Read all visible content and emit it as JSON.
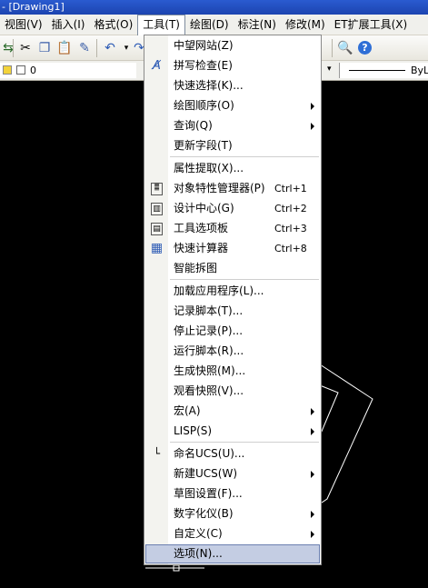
{
  "title_bar": {
    "text": "- [Drawing1]"
  },
  "menubar": [
    {
      "label": "视图(V)",
      "active": false
    },
    {
      "label": "插入(I)",
      "active": false
    },
    {
      "label": "格式(O)",
      "active": false
    },
    {
      "label": "工具(T)",
      "active": true
    },
    {
      "label": "绘图(D)",
      "active": false
    },
    {
      "label": "标注(N)",
      "active": false
    },
    {
      "label": "修改(M)",
      "active": false
    },
    {
      "label": "ET扩展工具(X)",
      "active": false
    }
  ],
  "layer_toolbar": {
    "current_layer": "0",
    "linetype_value": "ByL"
  },
  "tools_menu": {
    "items": [
      {
        "label": "中望网站(Z)"
      },
      {
        "label": "拼写检查(E)",
        "icon": "spell-check-icon"
      },
      {
        "label": "快速选择(K)..."
      },
      {
        "label": "绘图顺序(O)",
        "submenu": true
      },
      {
        "label": "查询(Q)",
        "submenu": true
      },
      {
        "label": "更新字段(T)"
      },
      {
        "label": "属性提取(X)..."
      },
      {
        "label": "对象特性管理器(P)",
        "shortcut": "Ctrl+1",
        "icon": "properties-icon"
      },
      {
        "label": "设计中心(G)",
        "shortcut": "Ctrl+2",
        "icon": "design-center-icon"
      },
      {
        "label": "工具选项板",
        "shortcut": "Ctrl+3",
        "icon": "tool-palette-icon"
      },
      {
        "label": "快速计算器",
        "shortcut": "Ctrl+8",
        "icon": "calculator-icon"
      },
      {
        "label": "智能拆图"
      },
      {
        "label": "加载应用程序(L)..."
      },
      {
        "label": "记录脚本(T)..."
      },
      {
        "label": "停止记录(P)..."
      },
      {
        "label": "运行脚本(R)..."
      },
      {
        "label": "生成快照(M)..."
      },
      {
        "label": "观看快照(V)..."
      },
      {
        "label": "宏(A)",
        "submenu": true
      },
      {
        "label": "LISP(S)",
        "submenu": true
      },
      {
        "label": "命名UCS(U)...",
        "icon": "ucs-icon"
      },
      {
        "label": "新建UCS(W)",
        "submenu": true
      },
      {
        "label": "草图设置(F)..."
      },
      {
        "label": "数字化仪(B)",
        "submenu": true
      },
      {
        "label": "自定义(C)",
        "submenu": true
      },
      {
        "label": "选项(N)...",
        "highlighted": true
      }
    ]
  }
}
